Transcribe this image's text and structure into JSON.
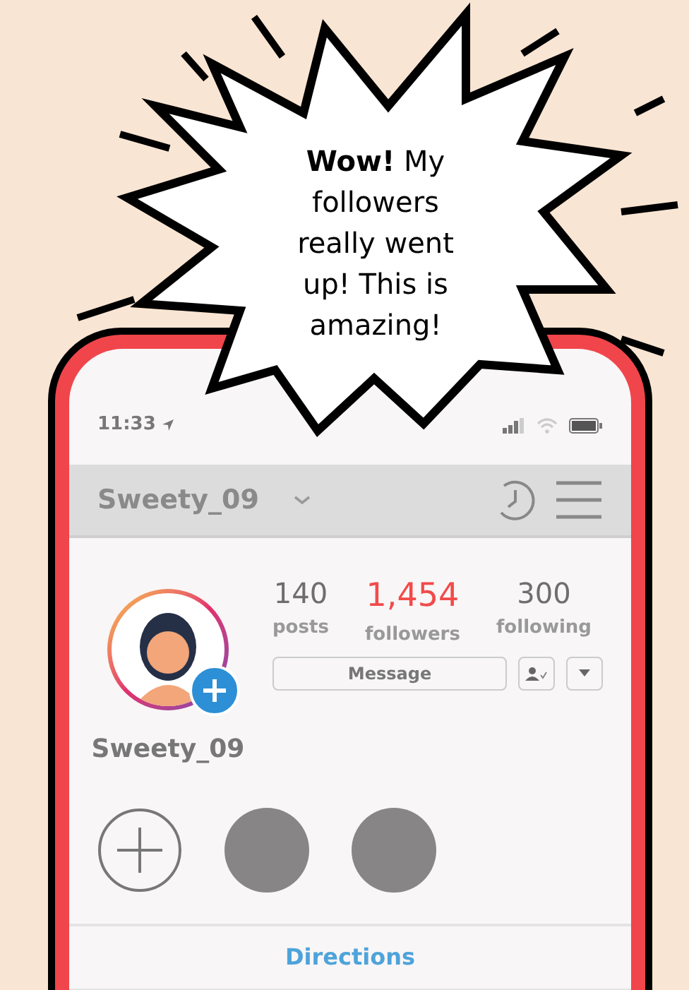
{
  "speech_bubble": {
    "text": "**Wow!** My followers really went up! This is amazing!"
  },
  "status_bar": {
    "time": "11:33"
  },
  "header": {
    "username": "Sweety_09"
  },
  "profile": {
    "username": "Sweety_09",
    "message_button": "Message",
    "stats": [
      {
        "value": "140",
        "label": "posts",
        "highlighted": false
      },
      {
        "value": "1,454",
        "label": "followers",
        "highlighted": true
      },
      {
        "value": "300",
        "label": "following",
        "highlighted": false
      }
    ]
  },
  "highlights": [
    {
      "kind": "new"
    },
    {
      "kind": "story"
    },
    {
      "kind": "story"
    }
  ],
  "tab_label": "Directions"
}
